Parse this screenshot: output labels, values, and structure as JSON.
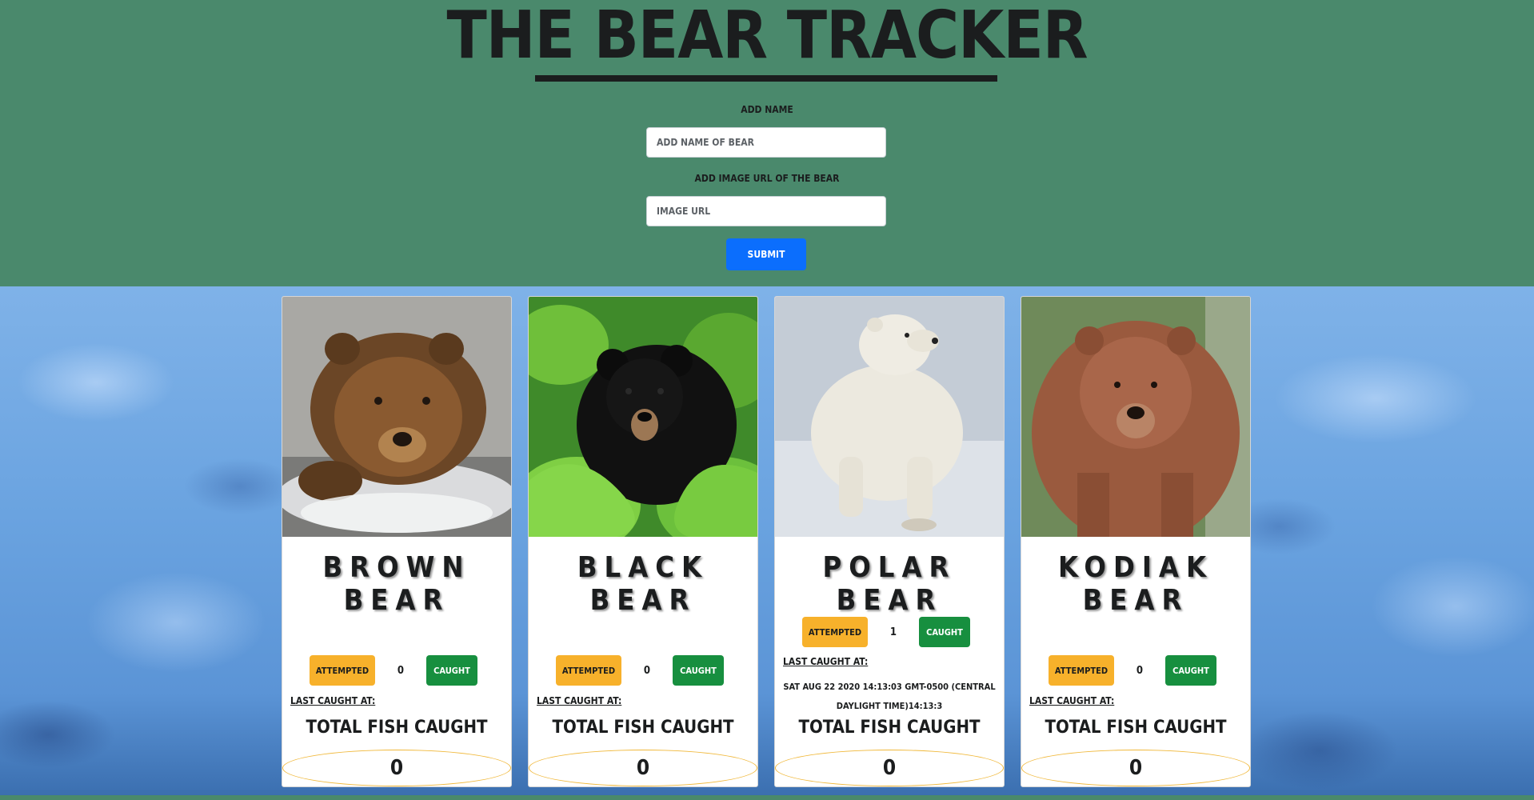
{
  "app": {
    "title": "The Bear Tracker"
  },
  "form": {
    "name_label": "Add Name",
    "name_placeholder": "Add Name of Bear",
    "name_value": "",
    "image_label": "Add Image URL of the bear",
    "image_placeholder": "Image URL",
    "image_value": "",
    "submit_label": "Submit"
  },
  "bears": [
    {
      "name": "Brown Bear",
      "attempted_label": "Attempted",
      "attempts": "0",
      "caught_label": "Caught",
      "last_caught_label": "Last Caught at:",
      "last_caught_value": "",
      "total_label": "Total Fish Caught",
      "total": "0",
      "image_icon": "brown-bear-photo"
    },
    {
      "name": "Black Bear",
      "attempted_label": "Attempted",
      "attempts": "0",
      "caught_label": "Caught",
      "last_caught_label": "Last Caught at:",
      "last_caught_value": "",
      "total_label": "Total Fish Caught",
      "total": "0",
      "image_icon": "black-bear-photo"
    },
    {
      "name": "Polar Bear",
      "attempted_label": "Attempted",
      "attempts": "1",
      "caught_label": "Caught",
      "last_caught_label": "Last Caught at:",
      "last_caught_value": "Sat Aug 22 2020 14:13:03 GMT-0500 (Central Daylight Time)14:13:3",
      "total_label": "Total Fish Caught",
      "total": "0",
      "image_icon": "polar-bear-photo"
    },
    {
      "name": "Kodiak Bear",
      "attempted_label": "Attempted",
      "attempts": "0",
      "caught_label": "Caught",
      "last_caught_label": "Last Caught at:",
      "last_caught_value": "",
      "total_label": "Total Fish Caught",
      "total": "0",
      "image_icon": "kodiak-bear-photo"
    }
  ],
  "colors": {
    "header_bg": "#4a896c",
    "submit": "#0b6efd",
    "attempted": "#f7b12b",
    "caught": "#178f3f",
    "water": "#6aa3e0"
  }
}
